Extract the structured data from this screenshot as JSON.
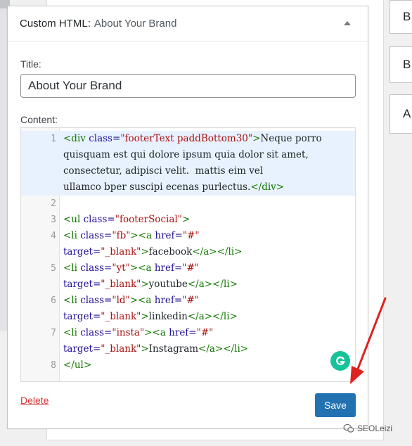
{
  "widget": {
    "title": "Custom HTML",
    "title_separator": ":",
    "subtitle": "About Your Brand",
    "title_label": "Title:",
    "title_value": "About Your Brand",
    "content_label": "Content:",
    "delete_label": "Delete",
    "save_label": "Save"
  },
  "right_column": {
    "items": [
      "B",
      "B",
      "A"
    ]
  },
  "editor": {
    "line_numbers": [
      "1",
      "2",
      "3",
      "4",
      "5",
      "6",
      "7",
      "8"
    ]
  },
  "code_tokens": {
    "l1a_tag": "<div ",
    "l1a_attr": "class=",
    "l1a_str": "\"footerText paddBottom30\"",
    "l1a_tag2": ">",
    "l1a_text": "Neque porro",
    "l1b_text": "quisquam est qui dolore ipsum quia dolor sit amet,",
    "l1c_text": "consectetur, adipisci velit.  mattis eim vel",
    "l1d_text": "ullamco bper suscipi ecenas purlectus.",
    "l1d_tag": "</div>",
    "l3_tag": "<ul ",
    "l3_attr": "class=",
    "l3_str": "\"footerSocial\"",
    "l3_tag2": ">",
    "l4a_tag": "<li ",
    "l4a_attr": "class=",
    "l4a_str": "\"fb\"",
    "l4a_tag2": "><a ",
    "l4a_attr2": "href=",
    "l4a_str2": "\"#\"",
    "l4b_attr": "target=",
    "l4b_str": "\"_blank\"",
    "l4b_tag": ">",
    "l4b_text": "facebook",
    "l4b_tag2": "</a></li>",
    "l5a_tag": "<li ",
    "l5a_attr": "class=",
    "l5a_str": "\"yt\"",
    "l5a_tag2": "><a ",
    "l5a_attr2": "href=",
    "l5a_str2": "\"#\"",
    "l5b_attr": "target=",
    "l5b_str": "\"_blank\"",
    "l5b_tag": ">",
    "l5b_text": "youtube",
    "l5b_tag2": "</a></li>",
    "l6a_tag": "<li ",
    "l6a_attr": "class=",
    "l6a_str": "\"ld\"",
    "l6a_tag2": "><a ",
    "l6a_attr2": "href=",
    "l6a_str2": "\"#\"",
    "l6b_attr": "target=",
    "l6b_str": "\"_blank\"",
    "l6b_tag": ">",
    "l6b_text": "linkedin",
    "l6b_tag2": "</a></li>",
    "l7a_tag": "<li ",
    "l7a_attr": "class=",
    "l7a_str": "\"insta\"",
    "l7a_tag2": "><a ",
    "l7a_attr2": "href=",
    "l7a_str2": "\"#\"",
    "l7b_attr": "target=",
    "l7b_str": "\"_blank\"",
    "l7b_tag": ">",
    "l7b_text": "Instagram",
    "l7b_tag2": "</a></li>",
    "l8_tag": "</ul>"
  },
  "watermark": "SEOLeizi",
  "colors": {
    "save_button": "#2271b1",
    "delete_link": "#d63638",
    "code_tag": "#117700",
    "code_attr": "#221199",
    "code_string": "#aa1111",
    "active_line": "#e8f2fe",
    "annotation_arrow": "#e02020",
    "grammarly": "#15c39a"
  },
  "icons": [
    "collapse-arrow-icon",
    "grammarly-icon",
    "wechat-icon",
    "red-arrow-annotation"
  ]
}
